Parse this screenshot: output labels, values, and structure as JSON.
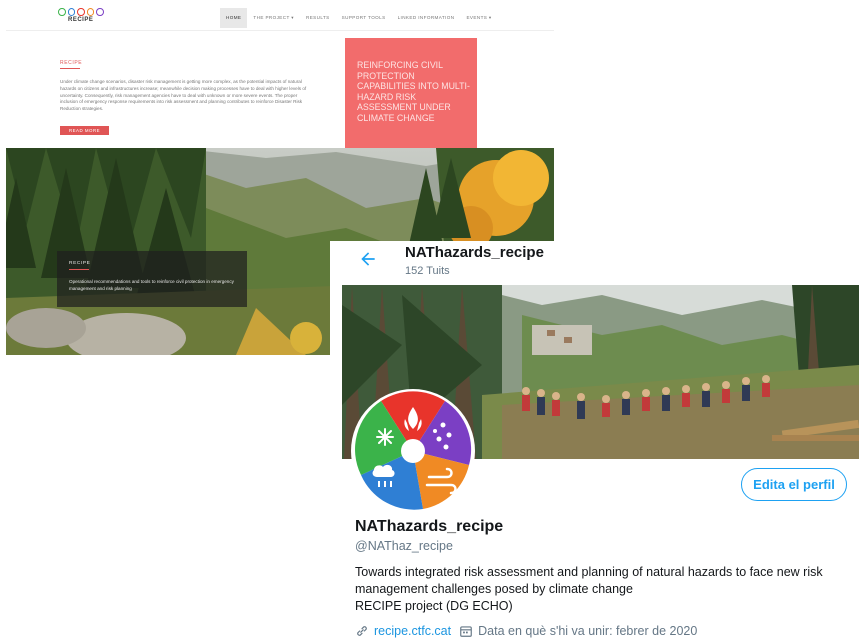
{
  "website": {
    "logo_text": "RECIPE",
    "nav": [
      "HOME",
      "THE PROJECT ▾",
      "RESULTS",
      "SUPPORT TOOLS",
      "LINKED INFORMATION",
      "EVENTS ▾"
    ],
    "intro": {
      "label": "RECIPE",
      "text": "Under climate change scenarios, disaster risk management is getting more complex, as the potential impacts of natural hazards on citizens and infrastructures increase; meanwhile decision making processes have to deal with higher levels of uncertainty. Consequently, risk management agencies have to deal with unknown or more severe events. The proper inclusion of emergency response requirements into risk assessment and planning contributes to reinforce Disaster Risk Reduction strategies.",
      "button": "READ MORE"
    },
    "highlight": "REINFORCING CIVIL PROTECTION CAPABILITIES INTO MULTI-HAZARD RISK ASSESSMENT UNDER CLIMATE CHANGE",
    "hero_card": {
      "label": "RECIPE",
      "text": "Operational recommendations and tools to reinforce civil protection in emergency management and risk planning"
    }
  },
  "twitter": {
    "header_name": "NAThazards_recipe",
    "tweet_count": "152 Tuits",
    "edit_button": "Edita el perfil",
    "name": "NAThazards_recipe",
    "handle": "@NAThaz_recipe",
    "bio": [
      "Towards integrated risk assessment and planning of natural hazards to face new risk",
      "management challenges posed by climate change",
      "RECIPE project (DG ECHO)"
    ],
    "link": "recipe.ctfc.cat",
    "joined": "Data en què s'hi va unir: febrer de 2020"
  },
  "colors": {
    "accent": "#e05555",
    "highlight_box": "#f26c6c",
    "twitter_blue": "#1da1f2",
    "fire": "#e8342b",
    "snow": "#3bb34a",
    "rain": "#2f7fd4",
    "wind": "#f08a24",
    "drought": "#7b3fc4"
  },
  "icons": [
    "back-arrow-icon",
    "link-icon",
    "calendar-icon",
    "fire-icon",
    "snowflake-icon",
    "rain-cloud-icon",
    "wind-icon",
    "drops-icon"
  ]
}
